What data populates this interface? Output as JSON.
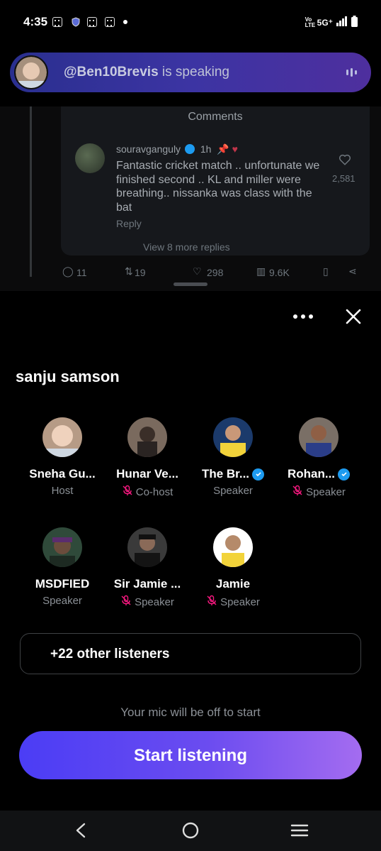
{
  "status_bar": {
    "time": "4:35",
    "network": "5G⁺",
    "volte": "Vo LTE"
  },
  "banner": {
    "handle": "@Ben10Brevis",
    "suffix": " is speaking"
  },
  "feed": {
    "comments_title": "Comments",
    "comment": {
      "user": "souravganguly",
      "time": "1h",
      "text": "Fantastic cricket match .. unfortunate we finished second .. KL and miller were breathing.. nissanka was class with the bat",
      "reply": "Reply",
      "likes": "2,581"
    },
    "more_replies": "View 8 more replies",
    "actions": {
      "replies": "11",
      "reposts": "19",
      "likes": "298",
      "views": "9.6K"
    }
  },
  "sheet": {
    "title": "sanju samson",
    "people": [
      {
        "name": "Sneha Gu...",
        "role": "Host",
        "verified": false,
        "muted": false
      },
      {
        "name": "Hunar Ve...",
        "role": "Co-host",
        "verified": false,
        "muted": true
      },
      {
        "name": "The Br...",
        "role": "Speaker",
        "verified": true,
        "muted": false
      },
      {
        "name": "Rohan...",
        "role": "Speaker",
        "verified": true,
        "muted": true
      },
      {
        "name": "MSDFIED",
        "role": "Speaker",
        "verified": false,
        "muted": false
      },
      {
        "name": "Sir Jamie ...",
        "role": "Speaker",
        "verified": false,
        "muted": true
      },
      {
        "name": "Jamie",
        "role": "Speaker",
        "verified": false,
        "muted": true
      }
    ],
    "listeners": "+22 other listeners",
    "mic_note": "Your mic will be off to start",
    "start_button": "Start listening"
  },
  "colors": {
    "accent_start": "#4b3df5",
    "accent_end": "#a46cf0",
    "verified": "#1d9bf0",
    "muted": "#f91880"
  }
}
